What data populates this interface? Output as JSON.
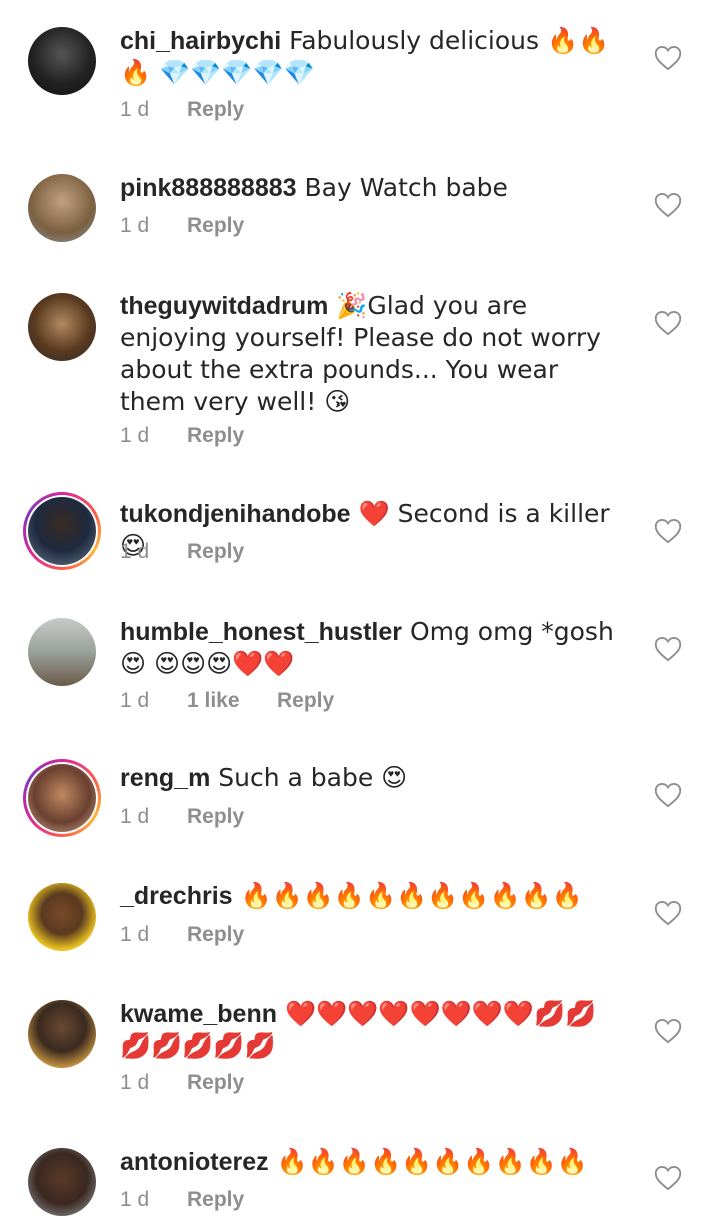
{
  "comments": [
    {
      "username": "chi_hairbychi",
      "text": " Fabulously delicious 🔥🔥🔥 💎💎💎💎💎",
      "time": "1 d",
      "likes": "",
      "reply": "Reply",
      "avatar_color": "#1a1a1a",
      "story_ring": false
    },
    {
      "username": "pink888888883",
      "text": " Bay Watch babe",
      "time": "1 d",
      "likes": "",
      "reply": "Reply",
      "avatar_color": "#8a7a60",
      "story_ring": false
    },
    {
      "username": "theguywitdadrum",
      "text": " 🎉Glad you are enjoying yourself! Please do not worry about the extra pounds... You wear them very well! 😘",
      "time": "1 d",
      "likes": "",
      "reply": "Reply",
      "avatar_color": "#6b4a2a",
      "story_ring": false
    },
    {
      "username": "tukondjenihandobe",
      "text": " ❤️ Second is a killer 😍",
      "time": "1 d",
      "likes": "",
      "reply": "Reply",
      "avatar_color": "#2a3a5a",
      "story_ring": true
    },
    {
      "username": "humble_honest_hustler",
      "text": " Omg omg *gosh 😍 😍😍😍❤️❤️",
      "time": "1 d",
      "likes": "1 like",
      "reply": "Reply",
      "avatar_color": "#9aa09a",
      "story_ring": false
    },
    {
      "username": "reng_m",
      "text": " Such a babe 😍",
      "time": "1 d",
      "likes": "",
      "reply": "Reply",
      "avatar_color": "#b08060",
      "story_ring": true
    },
    {
      "username": "_drechris",
      "text": " 🔥🔥🔥🔥🔥🔥🔥🔥🔥🔥🔥",
      "time": "1 d",
      "likes": "",
      "reply": "Reply",
      "avatar_color": "#e8c020",
      "story_ring": false
    },
    {
      "username": "kwame_benn",
      "text": " ❤️❤️❤️❤️❤️❤️❤️❤️💋💋 💋💋💋💋💋",
      "time": "1 d",
      "likes": "",
      "reply": "Reply",
      "avatar_color": "#5a4030",
      "story_ring": false
    },
    {
      "username": "antonioterez",
      "text": " 🔥🔥🔥🔥🔥🔥🔥🔥🔥🔥",
      "time": "1 d",
      "likes": "",
      "reply": "Reply",
      "avatar_color": "#4a3a30",
      "story_ring": false
    }
  ],
  "icons": {
    "like": "heart-outline-icon"
  },
  "colors": {
    "meta": "#8e8e8e",
    "text": "#262626"
  }
}
